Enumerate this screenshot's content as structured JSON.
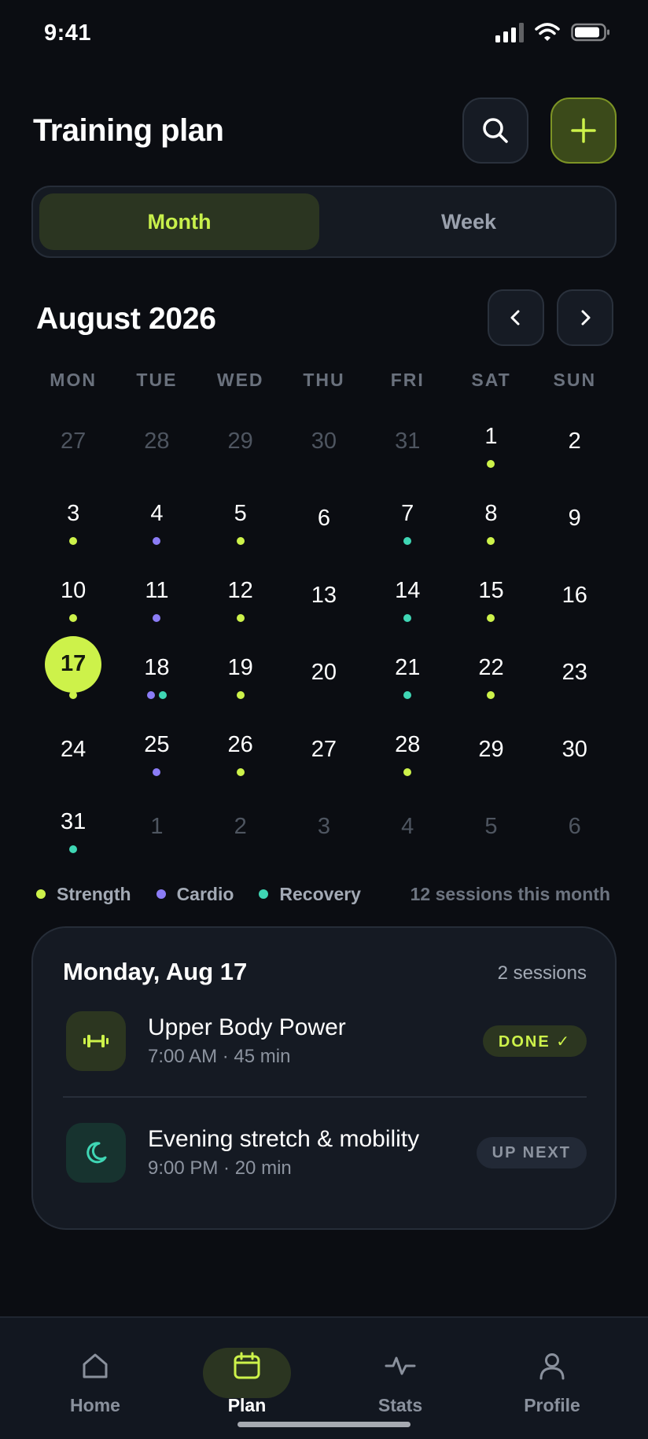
{
  "status_bar": {
    "time": "9:41"
  },
  "header": {
    "title": "Training plan",
    "search_icon": "search-icon",
    "add_icon": "plus-icon"
  },
  "view_toggle": {
    "options": [
      "Month",
      "Week"
    ],
    "selected": "Month"
  },
  "calendar": {
    "month_label": "August 2026",
    "weekdays": [
      "MON",
      "TUE",
      "WED",
      "THU",
      "FRI",
      "SAT",
      "SUN"
    ],
    "today": "17",
    "days": [
      {
        "label": "27",
        "muted": true,
        "dots": []
      },
      {
        "label": "28",
        "muted": true,
        "dots": []
      },
      {
        "label": "29",
        "muted": true,
        "dots": []
      },
      {
        "label": "30",
        "muted": true,
        "dots": []
      },
      {
        "label": "31",
        "muted": true,
        "dots": []
      },
      {
        "label": "1",
        "muted": false,
        "dots": [
          "strength"
        ]
      },
      {
        "label": "2",
        "muted": false,
        "dots": []
      },
      {
        "label": "3",
        "muted": false,
        "dots": [
          "strength"
        ]
      },
      {
        "label": "4",
        "muted": false,
        "dots": [
          "cardio"
        ]
      },
      {
        "label": "5",
        "muted": false,
        "dots": [
          "strength"
        ]
      },
      {
        "label": "6",
        "muted": false,
        "dots": []
      },
      {
        "label": "7",
        "muted": false,
        "dots": [
          "recovery"
        ]
      },
      {
        "label": "8",
        "muted": false,
        "dots": [
          "strength"
        ]
      },
      {
        "label": "9",
        "muted": false,
        "dots": []
      },
      {
        "label": "10",
        "muted": false,
        "dots": [
          "strength"
        ]
      },
      {
        "label": "11",
        "muted": false,
        "dots": [
          "cardio"
        ]
      },
      {
        "label": "12",
        "muted": false,
        "dots": [
          "strength"
        ]
      },
      {
        "label": "13",
        "muted": false,
        "dots": []
      },
      {
        "label": "14",
        "muted": false,
        "dots": [
          "recovery"
        ]
      },
      {
        "label": "15",
        "muted": false,
        "dots": [
          "strength"
        ]
      },
      {
        "label": "16",
        "muted": false,
        "dots": []
      },
      {
        "label": "17",
        "muted": false,
        "dots": [
          "strength"
        ],
        "today": true
      },
      {
        "label": "18",
        "muted": false,
        "dots": [
          "cardio",
          "recovery"
        ]
      },
      {
        "label": "19",
        "muted": false,
        "dots": [
          "strength"
        ]
      },
      {
        "label": "20",
        "muted": false,
        "dots": []
      },
      {
        "label": "21",
        "muted": false,
        "dots": [
          "recovery"
        ]
      },
      {
        "label": "22",
        "muted": false,
        "dots": [
          "strength"
        ]
      },
      {
        "label": "23",
        "muted": false,
        "dots": []
      },
      {
        "label": "24",
        "muted": false,
        "dots": []
      },
      {
        "label": "25",
        "muted": false,
        "dots": [
          "cardio"
        ]
      },
      {
        "label": "26",
        "muted": false,
        "dots": [
          "strength"
        ]
      },
      {
        "label": "27",
        "muted": false,
        "dots": []
      },
      {
        "label": "28",
        "muted": false,
        "dots": [
          "strength"
        ]
      },
      {
        "label": "29",
        "muted": false,
        "dots": []
      },
      {
        "label": "30",
        "muted": false,
        "dots": []
      },
      {
        "label": "31",
        "muted": false,
        "dots": [
          "recovery"
        ]
      },
      {
        "label": "1",
        "muted": true,
        "dots": []
      },
      {
        "label": "2",
        "muted": true,
        "dots": []
      },
      {
        "label": "3",
        "muted": true,
        "dots": []
      },
      {
        "label": "4",
        "muted": true,
        "dots": []
      },
      {
        "label": "5",
        "muted": true,
        "dots": []
      },
      {
        "label": "6",
        "muted": true,
        "dots": []
      }
    ]
  },
  "legend": {
    "items": [
      {
        "key": "strength",
        "label": "Strength",
        "color": "#cdf24a"
      },
      {
        "key": "cardio",
        "label": "Cardio",
        "color": "#8b7cf6"
      },
      {
        "key": "recovery",
        "label": "Recovery",
        "color": "#3fd6b4"
      }
    ],
    "summary": "12 sessions this month"
  },
  "day_card": {
    "title": "Monday, Aug 17",
    "count": "2 sessions",
    "sessions": [
      {
        "name": "Upper Body Power",
        "meta": "7:00 AM · 45 min",
        "badge": "DONE ✓",
        "icon": "dumbbell-icon",
        "type": "strength"
      },
      {
        "name": "Evening stretch & mobility",
        "meta": "9:00 PM · 20 min",
        "badge": "UP NEXT",
        "icon": "moon-icon",
        "type": "recovery"
      }
    ]
  },
  "tab_bar": {
    "tabs": [
      {
        "label": "Home",
        "icon": "home-icon"
      },
      {
        "label": "Plan",
        "icon": "calendar-icon",
        "active": true
      },
      {
        "label": "Stats",
        "icon": "activity-icon"
      },
      {
        "label": "Profile",
        "icon": "user-icon"
      }
    ]
  },
  "colors": {
    "accent": "#cdf24a",
    "background": "#0b0d12",
    "card": "#151a23"
  }
}
